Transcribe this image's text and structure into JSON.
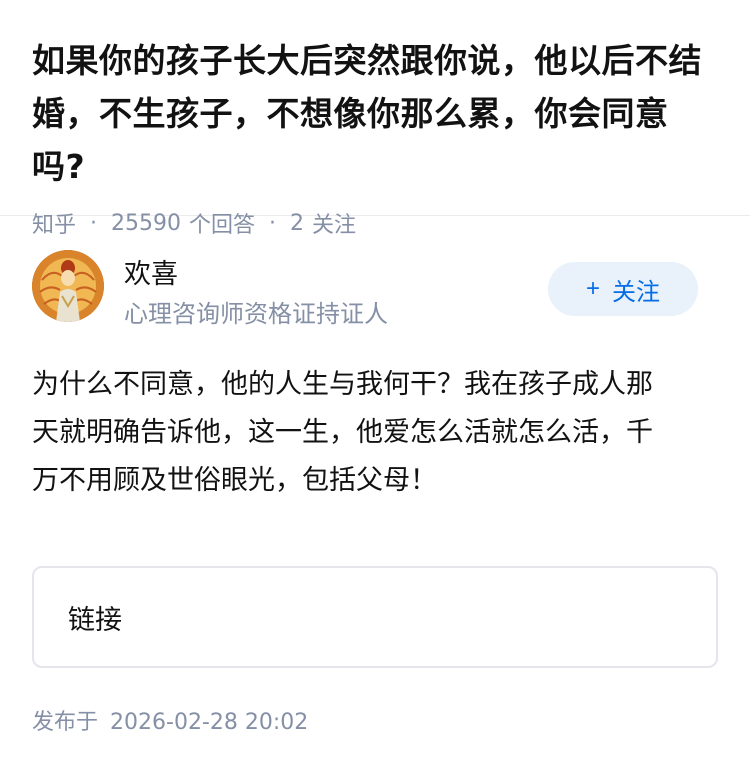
{
  "question": {
    "title": "如果你的孩子长大后突然跟你说，他以后不结婚，不生孩子，不想像你那么累，你会同意吗?",
    "source": "知乎",
    "answer_count": "25590",
    "answer_label": "个回答",
    "follow_count": "2",
    "follow_label": "关注"
  },
  "author": {
    "name": "欢喜",
    "description": "心理咨询师资格证持证人",
    "avatar_icon": "guanyin-avatar-image",
    "follow_button": {
      "plus": "+",
      "label": "关注"
    }
  },
  "answer": {
    "text": "为什么不同意，他的人生与我何干？我在孩子成人那天就明确告诉他，这一生，他爱怎么活就怎么活，千万不用顾及世俗眼光，包括父母！"
  },
  "link_card": {
    "label": "链接"
  },
  "footer": {
    "publish_label": "发布于",
    "publish_time": "2026-02-28 20:02"
  },
  "colors": {
    "text": "#121212",
    "meta": "#8590a6",
    "accent": "#056de8",
    "follow_bg": "#e9f1fb",
    "border": "#e4e6eb"
  }
}
